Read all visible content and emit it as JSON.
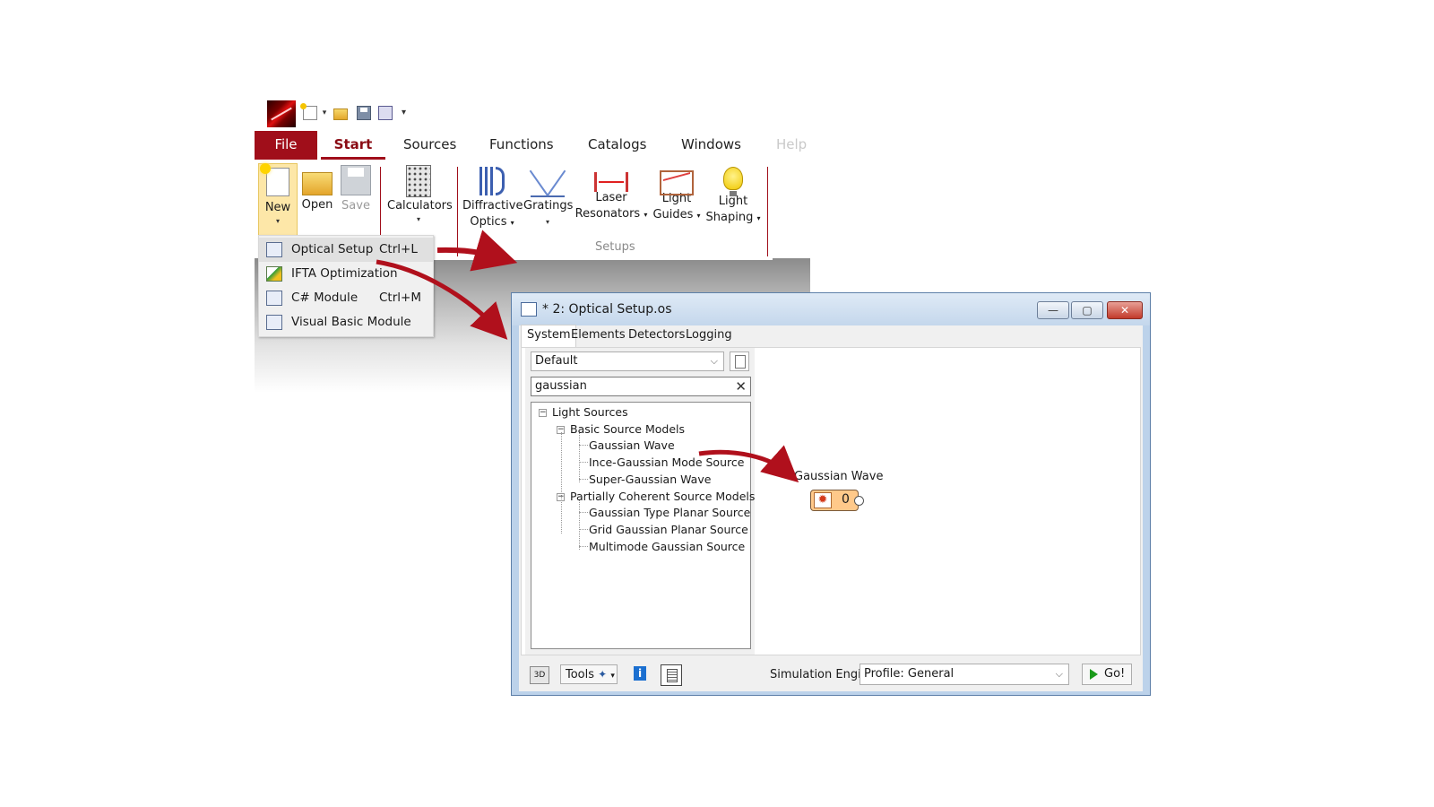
{
  "ribbon": {
    "tabs": [
      "File",
      "Start",
      "Sources",
      "Functions",
      "Catalogs",
      "Windows",
      "Help"
    ],
    "buttons": {
      "new": "New",
      "open": "Open",
      "save": "Save",
      "calculators": "Calculators",
      "diffractive_1": "Diffractive",
      "diffractive_2": "Optics",
      "gratings": "Gratings",
      "laser_1": "Laser",
      "laser_2": "Resonators",
      "guides_1": "Light",
      "guides_2": "Guides",
      "shaping_1": "Light",
      "shaping_2": "Shaping"
    },
    "group_label": "Setups",
    "dropdown_glyph": "▾",
    "new_menu": [
      {
        "label": "Optical Setup",
        "shortcut": "Ctrl+L"
      },
      {
        "label": "IFTA Optimization",
        "shortcut": ""
      },
      {
        "label": "C# Module",
        "shortcut": "Ctrl+M"
      },
      {
        "label": "Visual Basic Module",
        "shortcut": ""
      }
    ]
  },
  "window": {
    "title": "* 2: Optical Setup.os",
    "controls": {
      "minimize": "—",
      "maximize": "▢",
      "close": "✕"
    },
    "tabs": [
      "System",
      "Elements",
      "Detectors",
      "Logging"
    ],
    "catalog_combo": "Default",
    "search_value": "gaussian",
    "search_clear": "✕",
    "combo_chevron": "⌵",
    "tree": {
      "root": "Light Sources",
      "groups": [
        {
          "label": "Basic Source Models",
          "items": [
            "Gaussian Wave",
            "Ince-Gaussian Mode Source",
            "Super-Gaussian Wave"
          ]
        },
        {
          "label": "Partially Coherent Source Models",
          "items": [
            "Gaussian Type Planar Source",
            "Grid Gaussian Planar Source",
            "Multimode Gaussian Source"
          ]
        }
      ],
      "expander": "−"
    },
    "canvas_node": {
      "label": "Gaussian Wave",
      "icon": "✹",
      "port": "0"
    },
    "bottom": {
      "three_d": "3D",
      "tools": "Tools",
      "tools_glyph": "▾",
      "info": "i",
      "engine_label": "Simulation Engine",
      "profile": "Profile: General",
      "go": "Go!"
    }
  },
  "colors": {
    "accent": "#a00e1a",
    "arrow": "#b0101c",
    "node_fill": "#ffc98a",
    "window_frame": "#bcd2ea"
  }
}
